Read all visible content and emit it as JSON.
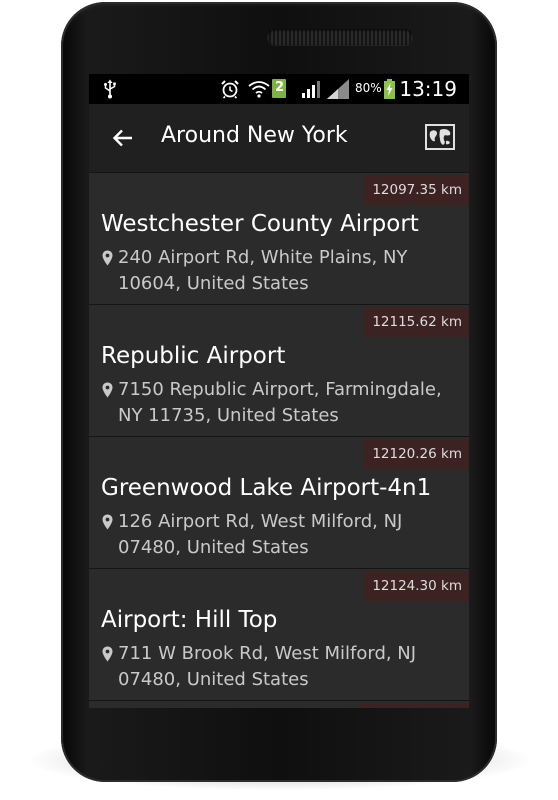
{
  "status_bar": {
    "icons": [
      "usb-icon",
      "alarm-icon",
      "wifi-icon",
      "sim-2-icon",
      "signal-icon",
      "signal-icon",
      "battery-charging-icon"
    ],
    "sim_slot": "2",
    "battery_percent": "80%",
    "time": "13:19"
  },
  "action_bar": {
    "back_icon": "back-arrow-icon",
    "title": "Around New York",
    "map_icon": "map-icon"
  },
  "places": [
    {
      "distance": "12097.35 km",
      "name": "Westchester County Airport",
      "address": "240 Airport Rd, White Plains, NY 10604, United States"
    },
    {
      "distance": "12115.62 km",
      "name": "Republic Airport",
      "address": "7150 Republic Airport, Farmingdale, NY 11735, United States"
    },
    {
      "distance": "12120.26 km",
      "name": "Greenwood Lake Airport-4n1",
      "address": "126 Airport Rd, West Milford, NJ 07480, United States"
    },
    {
      "distance": "12124.30 km",
      "name": "Airport: Hill Top",
      "address": "711 W Brook Rd, West Milford, NJ 07480, United States"
    }
  ],
  "colors": {
    "screen_bg": "#2a2a2a",
    "action_bar_bg": "#202020",
    "distance_badge_bg": "#3d2222",
    "text_primary": "#ffffff",
    "text_secondary": "#c9c9c9",
    "battery_accent": "#8bc34a"
  }
}
